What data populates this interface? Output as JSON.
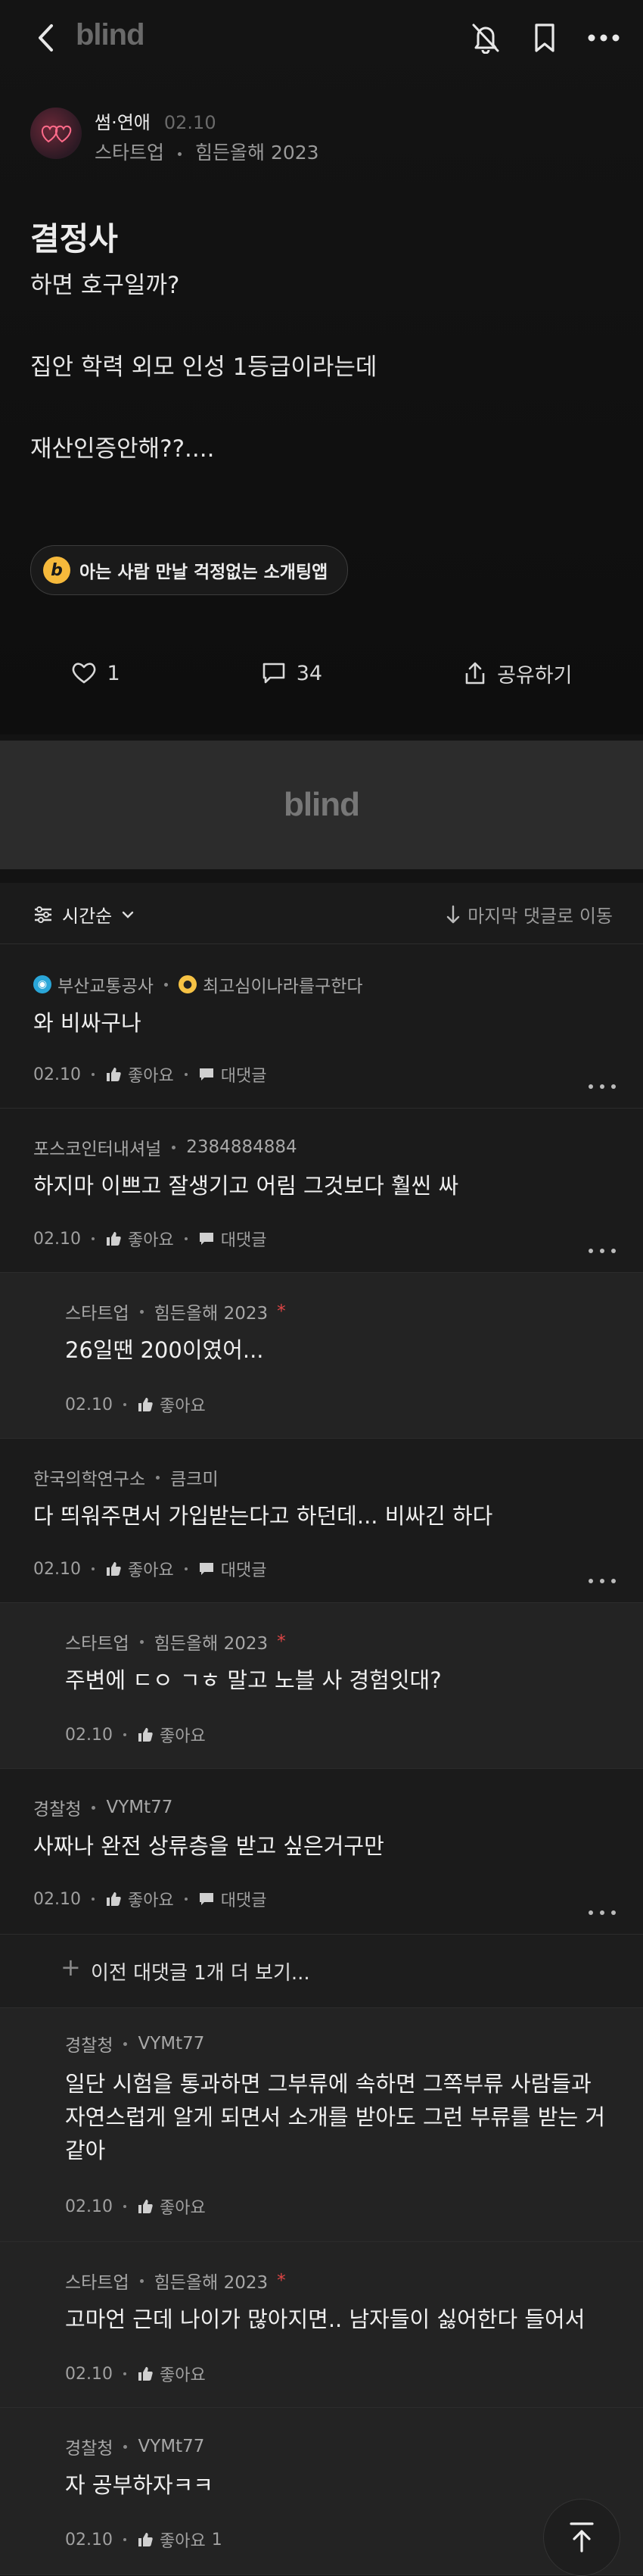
{
  "app": {
    "logo": "blind",
    "banner_logo": "blind"
  },
  "post": {
    "category": "썸·연애",
    "date": "02.10",
    "company": "스타트업",
    "nickname": "힘든올해 2023",
    "title": "결정사",
    "body": "하면 호구일까?\n\n집안 학력 외모 인성 1등급이라는데\n\n재산인증안해??....",
    "promo": "아는 사람 만날 걱정없는 소개팅앱",
    "promo_badge": "b",
    "likes": "1",
    "comments": "34",
    "share": "공유하기"
  },
  "sortbar": {
    "sort_label": "시간순",
    "last_comment": "마지막 댓글로 이동"
  },
  "labels": {
    "like": "좋아요",
    "reply": "대댓글"
  },
  "comments": [
    {
      "company": "부산교통공사",
      "nickname": "최고심이나라를구한다",
      "text": "와 비싸구나",
      "date": "02.10",
      "reply": true,
      "likes": ""
    },
    {
      "company": "포스코인터내셔널",
      "nickname": "2384884884",
      "text": "하지마 이쁘고 잘생기고 어림 그것보다 훨씬 싸",
      "date": "02.10",
      "reply": true,
      "likes": ""
    },
    {
      "company": "스타트업",
      "nickname": "힘든올해 2023",
      "text": "26일땐 200이였어...",
      "date": "02.10",
      "reply": false,
      "likes": "",
      "author": true,
      "star": "*"
    },
    {
      "company": "한국의학연구소",
      "nickname": "큼크미",
      "text": "다 띄워주면서 가입받는다고 하던데... 비싸긴 하다",
      "date": "02.10",
      "reply": true,
      "likes": ""
    },
    {
      "company": "스타트업",
      "nickname": "힘든올해 2023",
      "text": "주변에 ㄷㅇ ㄱㅎ 말고 노블 사 경험잇대?",
      "date": "02.10",
      "reply": false,
      "likes": "",
      "author": true,
      "star": "*"
    },
    {
      "company": "경찰청",
      "nickname": "VYMt77",
      "text": "사짜나 완전 상류층을 받고 싶은거구만",
      "date": "02.10",
      "reply": true,
      "likes": ""
    }
  ],
  "load_more": {
    "plus": "+",
    "text": "이전 대댓글 1개 더 보기..."
  },
  "replies": [
    {
      "company": "경찰청",
      "nickname": "VYMt77",
      "text": "일단 시험을 통과하면 그부류에 속하면 그쪽부류 사람들과 자연스럽게 알게 되면서 소개를 받아도 그런 부류를 받는 거 같아",
      "date": "02.10",
      "likes": ""
    },
    {
      "company": "스타트업",
      "nickname": "힘든올해 2023",
      "text": "고마언 근데 나이가 많아지면.. 남자들이 싫어한다 들어서",
      "date": "02.10",
      "likes": "",
      "star": "*"
    },
    {
      "company": "경찰청",
      "nickname": "VYMt77",
      "text": "자 공부하자ㅋㅋ",
      "date": "02.10",
      "likes": "1"
    }
  ]
}
